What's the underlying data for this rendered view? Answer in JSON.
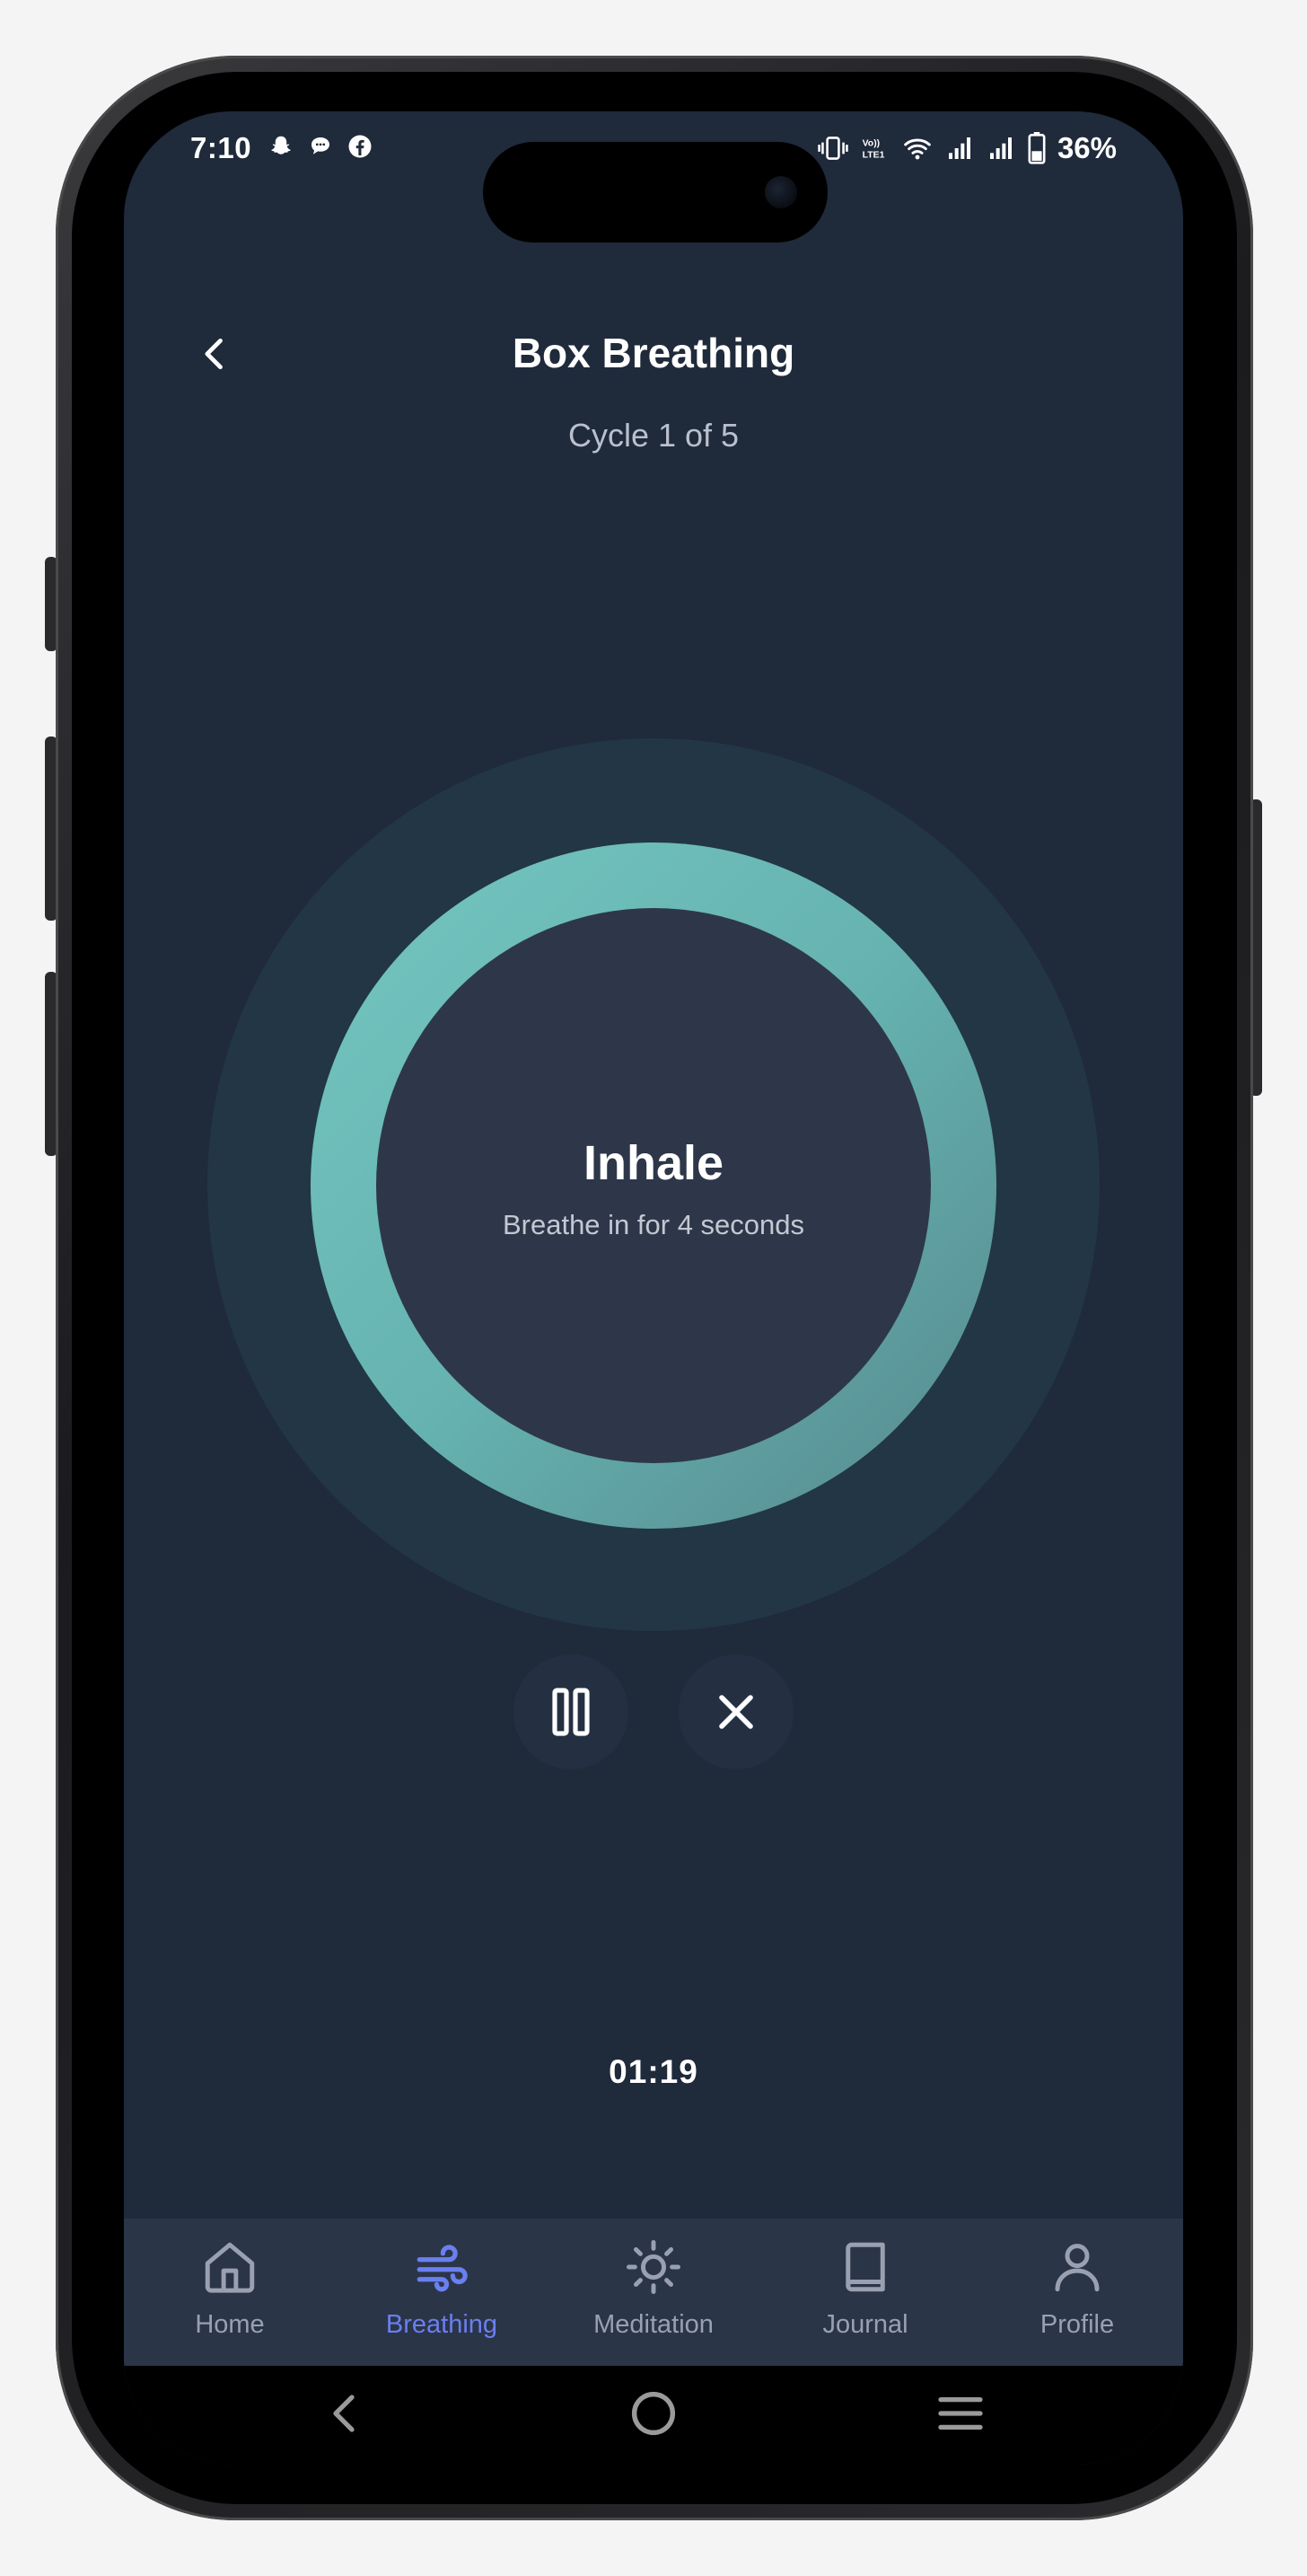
{
  "status_bar": {
    "time": "7:10",
    "left_icons": [
      "snapchat-icon",
      "chat-bubble-icon",
      "facebook-icon"
    ],
    "right_icons": [
      "vibrate-icon",
      "volte-icon",
      "wifi-icon",
      "signal-icon",
      "signal-icon",
      "battery-icon"
    ],
    "battery_percent": "36%"
  },
  "header": {
    "title": "Box Breathing",
    "back_icon": "chevron-left-icon"
  },
  "session": {
    "cycle_text": "Cycle 1 of 5",
    "phase": "Inhale",
    "phase_instruction": "Breathe in for 4 seconds",
    "timer": "01:19"
  },
  "controls": {
    "pause_icon": "pause-icon",
    "stop_icon": "close-icon"
  },
  "tabs": [
    {
      "label": "Home",
      "icon": "home-icon",
      "active": false
    },
    {
      "label": "Breathing",
      "icon": "wind-icon",
      "active": true
    },
    {
      "label": "Meditation",
      "icon": "sun-icon",
      "active": false
    },
    {
      "label": "Journal",
      "icon": "book-icon",
      "active": false
    },
    {
      "label": "Profile",
      "icon": "user-icon",
      "active": false
    }
  ],
  "colors": {
    "background": "#1f2a3b",
    "ring": "#6cbcb9",
    "inner_disc": "#2e3749",
    "tab_bar": "#2b3548",
    "active_tab": "#6a7ff0",
    "inactive_tab": "#99a1b0"
  }
}
